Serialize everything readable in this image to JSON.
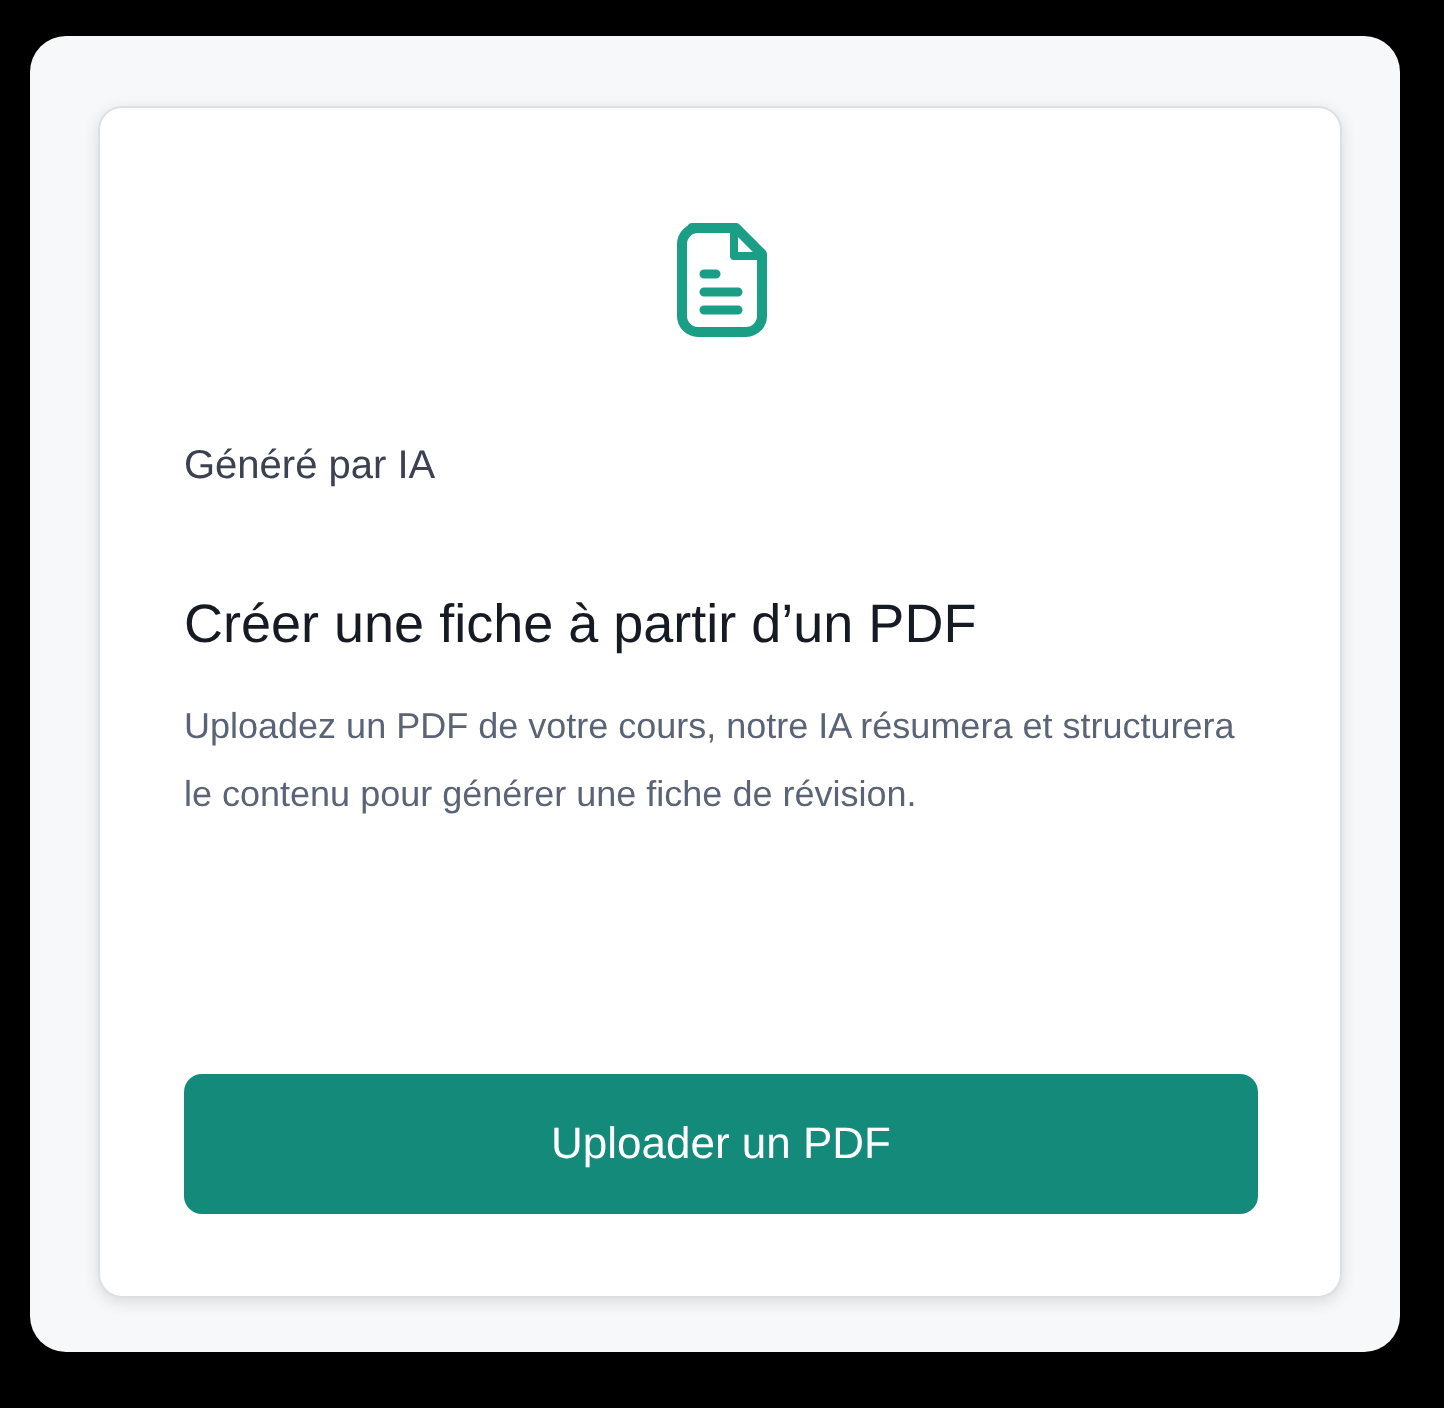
{
  "card": {
    "tag": "Généré par IA",
    "title": "Créer une fiche à partir d’un PDF",
    "description": "Uploadez un PDF de votre cours, notre IA résumera et structurera le contenu pour générer une fiche de révision.",
    "button": "Uploader un PDF"
  }
}
